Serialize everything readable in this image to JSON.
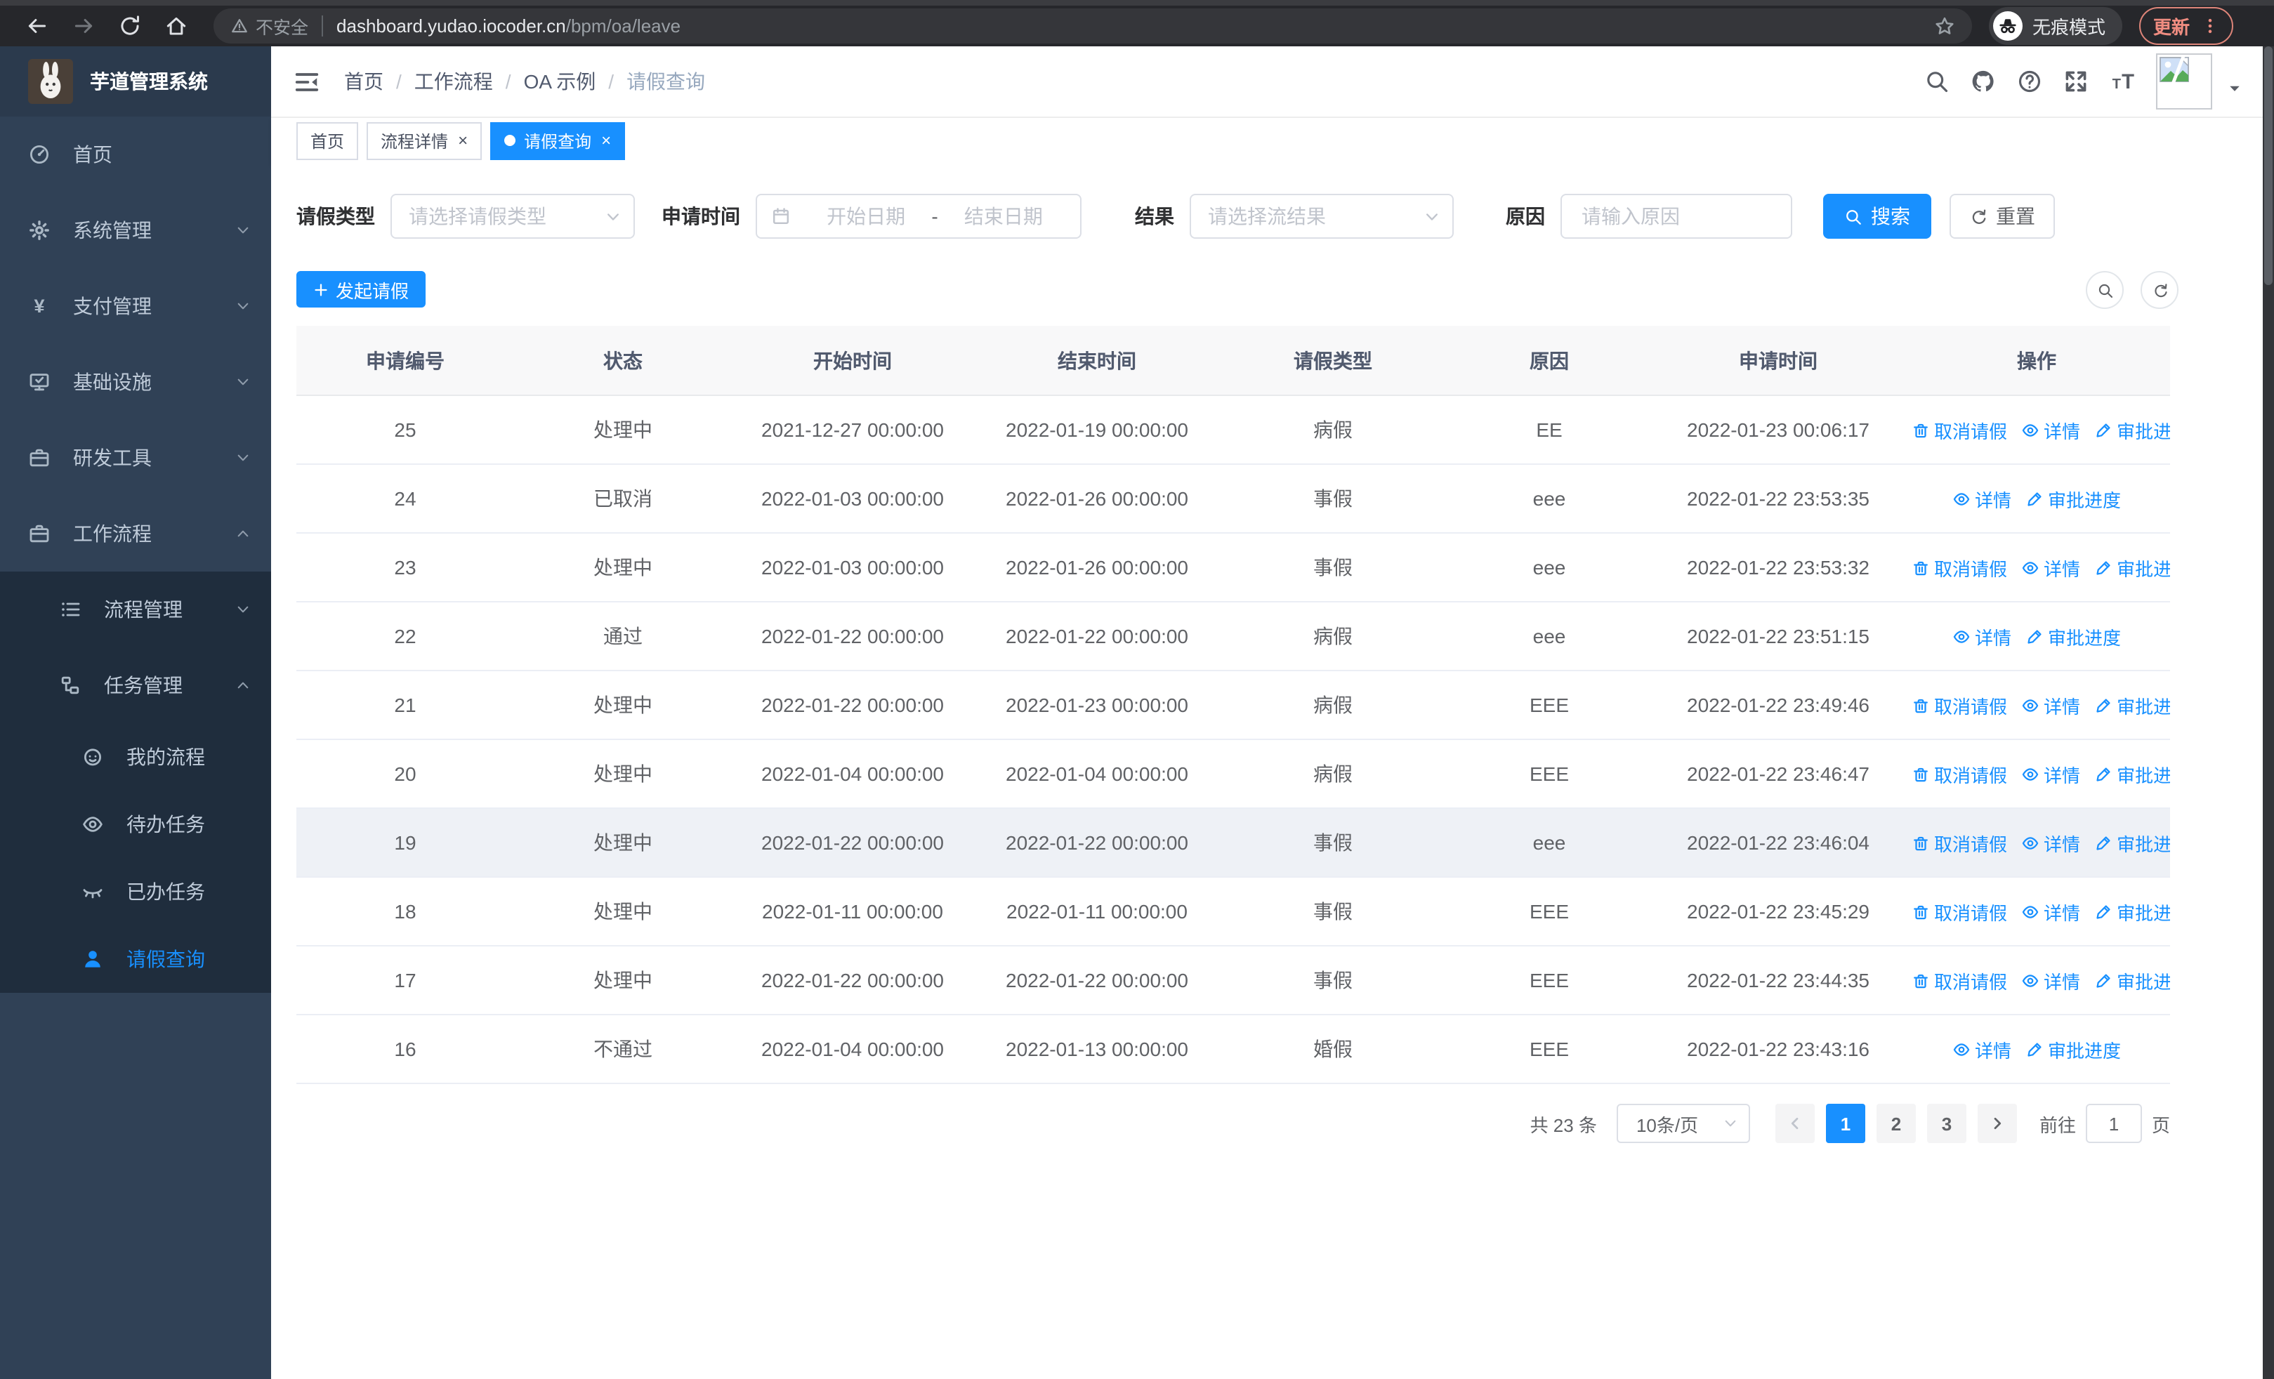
{
  "colors": {
    "primary": "#1890ff",
    "sidebar_bg": "#304156",
    "submenu_bg": "#1f2d3d",
    "link": "#1890ff",
    "update_accent": "#ef8c80"
  },
  "browser": {
    "security_label": "不安全",
    "url_host": "dashboard.yudao.iocoder.cn",
    "url_path": "/bpm/oa/leave",
    "incognito_label": "无痕模式",
    "update_label": "更新",
    "nav_icons": [
      "back-arrow-icon",
      "forward-arrow-icon",
      "reload-icon",
      "home-icon"
    ]
  },
  "app": {
    "title": "芋道管理系统",
    "logo_icon": "rabbit-logo"
  },
  "sidebar": {
    "items": [
      {
        "label": "首页",
        "icon": "dashboard-icon"
      },
      {
        "label": "系统管理",
        "icon": "gear-icon",
        "state": "collapsed"
      },
      {
        "label": "支付管理",
        "icon": "yen-icon",
        "state": "collapsed"
      },
      {
        "label": "基础设施",
        "icon": "monitor-icon",
        "state": "collapsed"
      },
      {
        "label": "研发工具",
        "icon": "briefcase-icon",
        "state": "collapsed"
      },
      {
        "label": "工作流程",
        "icon": "briefcase-icon",
        "state": "expanded",
        "children": [
          {
            "label": "流程管理",
            "icon": "list-icon",
            "state": "collapsed"
          },
          {
            "label": "任务管理",
            "icon": "nodes-icon",
            "state": "expanded",
            "children": [
              {
                "label": "我的流程",
                "icon": "face-icon"
              },
              {
                "label": "待办任务",
                "icon": "eye-icon"
              },
              {
                "label": "已办任务",
                "icon": "eye-closed-icon"
              },
              {
                "label": "请假查询",
                "icon": "user-icon",
                "active": true
              }
            ]
          }
        ]
      }
    ]
  },
  "header": {
    "breadcrumb": [
      "首页",
      "工作流程",
      "OA 示例",
      "请假查询"
    ],
    "icons": [
      "search-icon",
      "github-icon",
      "help-icon",
      "fullscreen-icon",
      "fontsize-icon"
    ]
  },
  "tabs": [
    {
      "label": "首页",
      "closable": false,
      "active": false
    },
    {
      "label": "流程详情",
      "closable": true,
      "active": false
    },
    {
      "label": "请假查询",
      "closable": true,
      "active": true
    }
  ],
  "filters": {
    "leave_type": {
      "label": "请假类型",
      "placeholder": "请选择请假类型"
    },
    "apply_time": {
      "label": "申请时间",
      "start_placeholder": "开始日期",
      "separator": "-",
      "end_placeholder": "结束日期"
    },
    "result": {
      "label": "结果",
      "placeholder": "请选择流结果"
    },
    "reason": {
      "label": "原因",
      "placeholder": "请输入原因"
    },
    "search_label": "搜索",
    "reset_label": "重置"
  },
  "toolbar": {
    "create_label": "发起请假"
  },
  "table": {
    "columns": [
      "申请编号",
      "状态",
      "开始时间",
      "结束时间",
      "请假类型",
      "原因",
      "申请时间",
      "操作"
    ],
    "action_defs": {
      "cancel": {
        "label": "取消请假",
        "icon": "trash-icon"
      },
      "detail": {
        "label": "详情",
        "icon": "eye-icon"
      },
      "progress": {
        "label": "审批进度",
        "icon": "pen-icon"
      }
    },
    "rows": [
      {
        "id": "25",
        "status": "处理中",
        "start": "2021-12-27 00:00:00",
        "end": "2022-01-19 00:00:00",
        "type": "病假",
        "reason": "EE",
        "apply": "2022-01-23 00:06:17",
        "actions": [
          "cancel",
          "detail",
          "progress"
        ]
      },
      {
        "id": "24",
        "status": "已取消",
        "start": "2022-01-03 00:00:00",
        "end": "2022-01-26 00:00:00",
        "type": "事假",
        "reason": "eee",
        "apply": "2022-01-22 23:53:35",
        "actions": [
          "detail",
          "progress"
        ]
      },
      {
        "id": "23",
        "status": "处理中",
        "start": "2022-01-03 00:00:00",
        "end": "2022-01-26 00:00:00",
        "type": "事假",
        "reason": "eee",
        "apply": "2022-01-22 23:53:32",
        "actions": [
          "cancel",
          "detail",
          "progress"
        ]
      },
      {
        "id": "22",
        "status": "通过",
        "start": "2022-01-22 00:00:00",
        "end": "2022-01-22 00:00:00",
        "type": "病假",
        "reason": "eee",
        "apply": "2022-01-22 23:51:15",
        "actions": [
          "detail",
          "progress"
        ]
      },
      {
        "id": "21",
        "status": "处理中",
        "start": "2022-01-22 00:00:00",
        "end": "2022-01-23 00:00:00",
        "type": "病假",
        "reason": "EEE",
        "apply": "2022-01-22 23:49:46",
        "actions": [
          "cancel",
          "detail",
          "progress"
        ]
      },
      {
        "id": "20",
        "status": "处理中",
        "start": "2022-01-04 00:00:00",
        "end": "2022-01-04 00:00:00",
        "type": "病假",
        "reason": "EEE",
        "apply": "2022-01-22 23:46:47",
        "actions": [
          "cancel",
          "detail",
          "progress"
        ]
      },
      {
        "id": "19",
        "status": "处理中",
        "start": "2022-01-22 00:00:00",
        "end": "2022-01-22 00:00:00",
        "type": "事假",
        "reason": "eee",
        "apply": "2022-01-22 23:46:04",
        "actions": [
          "cancel",
          "detail",
          "progress"
        ],
        "highlight": true
      },
      {
        "id": "18",
        "status": "处理中",
        "start": "2022-01-11 00:00:00",
        "end": "2022-01-11 00:00:00",
        "type": "事假",
        "reason": "EEE",
        "apply": "2022-01-22 23:45:29",
        "actions": [
          "cancel",
          "detail",
          "progress"
        ]
      },
      {
        "id": "17",
        "status": "处理中",
        "start": "2022-01-22 00:00:00",
        "end": "2022-01-22 00:00:00",
        "type": "事假",
        "reason": "EEE",
        "apply": "2022-01-22 23:44:35",
        "actions": [
          "cancel",
          "detail",
          "progress"
        ]
      },
      {
        "id": "16",
        "status": "不通过",
        "start": "2022-01-04 00:00:00",
        "end": "2022-01-13 00:00:00",
        "type": "婚假",
        "reason": "EEE",
        "apply": "2022-01-22 23:43:16",
        "actions": [
          "detail",
          "progress"
        ]
      }
    ]
  },
  "pagination": {
    "total_label": "共 23 条",
    "page_size": "10条/页",
    "pages": [
      "1",
      "2",
      "3"
    ],
    "active_page": "1",
    "goto_label": "前往",
    "goto_value": "1",
    "unit": "页"
  }
}
